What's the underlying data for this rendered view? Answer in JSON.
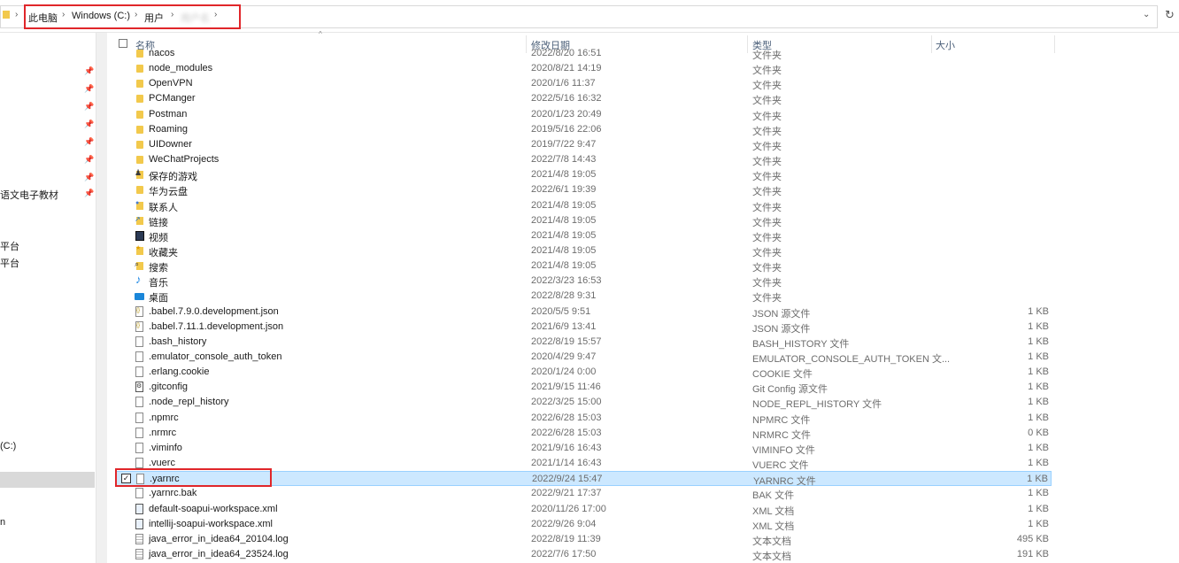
{
  "breadcrumb": {
    "items": [
      "此电脑",
      "Windows (C:)",
      "用户",
      "用户名"
    ],
    "user_redacted": "用户名"
  },
  "nav": {
    "labels": [
      {
        "text": "语文电子教材",
        "top": 0
      },
      {
        "text": "平台",
        "top": 0
      },
      {
        "text": "平台",
        "top": 0
      },
      {
        "text": "(C:)",
        "top": 0
      },
      {
        "text": "n",
        "top": 0
      }
    ]
  },
  "columns": {
    "name": "名称",
    "date": "修改日期",
    "type": "类型",
    "size": "大小"
  },
  "files": [
    {
      "name": "nacos",
      "date": "2022/8/20 16:51",
      "type": "文件夹",
      "size": "",
      "icon": "folder-icon"
    },
    {
      "name": "node_modules",
      "date": "2020/8/21 14:19",
      "type": "文件夹",
      "size": "",
      "icon": "folder-icon"
    },
    {
      "name": "OpenVPN",
      "date": "2020/1/6 11:37",
      "type": "文件夹",
      "size": "",
      "icon": "folder-icon"
    },
    {
      "name": "PCManger",
      "date": "2022/5/16 16:32",
      "type": "文件夹",
      "size": "",
      "icon": "folder-icon"
    },
    {
      "name": "Postman",
      "date": "2020/1/23 20:49",
      "type": "文件夹",
      "size": "",
      "icon": "folder-icon"
    },
    {
      "name": "Roaming",
      "date": "2019/5/16 22:06",
      "type": "文件夹",
      "size": "",
      "icon": "folder-icon"
    },
    {
      "name": "UIDowner",
      "date": "2019/7/22 9:47",
      "type": "文件夹",
      "size": "",
      "icon": "folder-icon"
    },
    {
      "name": "WeChatProjects",
      "date": "2022/7/8 14:43",
      "type": "文件夹",
      "size": "",
      "icon": "folder-icon"
    },
    {
      "name": "保存的游戏",
      "date": "2021/4/8 19:05",
      "type": "文件夹",
      "size": "",
      "icon": "saved-games-icon"
    },
    {
      "name": "华为云盘",
      "date": "2022/6/1 19:39",
      "type": "文件夹",
      "size": "",
      "icon": "folder-icon"
    },
    {
      "name": "联系人",
      "date": "2021/4/8 19:05",
      "type": "文件夹",
      "size": "",
      "icon": "contacts-icon"
    },
    {
      "name": "链接",
      "date": "2021/4/8 19:05",
      "type": "文件夹",
      "size": "",
      "icon": "links-icon"
    },
    {
      "name": "视频",
      "date": "2021/4/8 19:05",
      "type": "文件夹",
      "size": "",
      "icon": "video-icon"
    },
    {
      "name": "收藏夹",
      "date": "2021/4/8 19:05",
      "type": "文件夹",
      "size": "",
      "icon": "favorites-icon"
    },
    {
      "name": "搜索",
      "date": "2021/4/8 19:05",
      "type": "文件夹",
      "size": "",
      "icon": "searches-icon"
    },
    {
      "name": "音乐",
      "date": "2022/3/23 16:53",
      "type": "文件夹",
      "size": "",
      "icon": "music-icon"
    },
    {
      "name": "桌面",
      "date": "2022/8/28 9:31",
      "type": "文件夹",
      "size": "",
      "icon": "desktop-icon"
    },
    {
      "name": ".babel.7.9.0.development.json",
      "date": "2020/5/5 9:51",
      "type": "JSON 源文件",
      "size": "1 KB",
      "icon": "json-file-icon"
    },
    {
      "name": ".babel.7.11.1.development.json",
      "date": "2021/6/9 13:41",
      "type": "JSON 源文件",
      "size": "1 KB",
      "icon": "json-file-icon"
    },
    {
      "name": ".bash_history",
      "date": "2022/8/19 15:57",
      "type": "BASH_HISTORY 文件",
      "size": "1 KB",
      "icon": "file-icon"
    },
    {
      "name": ".emulator_console_auth_token",
      "date": "2020/4/29 9:47",
      "type": "EMULATOR_CONSOLE_AUTH_TOKEN 文...",
      "size": "1 KB",
      "icon": "file-icon"
    },
    {
      "name": ".erlang.cookie",
      "date": "2020/1/24 0:00",
      "type": "COOKIE 文件",
      "size": "1 KB",
      "icon": "file-icon"
    },
    {
      "name": ".gitconfig",
      "date": "2021/9/15 11:46",
      "type": "Git Config 源文件",
      "size": "1 KB",
      "icon": "gitconfig-file-icon"
    },
    {
      "name": ".node_repl_history",
      "date": "2022/3/25 15:00",
      "type": "NODE_REPL_HISTORY 文件",
      "size": "1 KB",
      "icon": "file-icon"
    },
    {
      "name": ".npmrc",
      "date": "2022/6/28 15:03",
      "type": "NPMRC 文件",
      "size": "1 KB",
      "icon": "file-icon"
    },
    {
      "name": ".nrmrc",
      "date": "2022/6/28 15:03",
      "type": "NRMRC 文件",
      "size": "0 KB",
      "icon": "file-icon"
    },
    {
      "name": ".viminfo",
      "date": "2021/9/16 16:43",
      "type": "VIMINFO 文件",
      "size": "1 KB",
      "icon": "file-icon"
    },
    {
      "name": ".vuerc",
      "date": "2021/1/14 16:43",
      "type": "VUERC 文件",
      "size": "1 KB",
      "icon": "file-icon"
    },
    {
      "name": ".yarnrc",
      "date": "2022/9/24 15:47",
      "type": "YARNRC 文件",
      "size": "1 KB",
      "icon": "file-icon",
      "selected": true
    },
    {
      "name": ".yarnrc.bak",
      "date": "2022/9/21 17:37",
      "type": "BAK 文件",
      "size": "1 KB",
      "icon": "file-icon"
    },
    {
      "name": "default-soapui-workspace.xml",
      "date": "2020/11/26 17:00",
      "type": "XML 文档",
      "size": "1 KB",
      "icon": "xml-file-icon"
    },
    {
      "name": "intellij-soapui-workspace.xml",
      "date": "2022/9/26 9:04",
      "type": "XML 文档",
      "size": "1 KB",
      "icon": "xml-file-icon"
    },
    {
      "name": "java_error_in_idea64_20104.log",
      "date": "2022/8/19 11:39",
      "type": "文本文档",
      "size": "495 KB",
      "icon": "text-file-icon"
    },
    {
      "name": "java_error_in_idea64_23524.log",
      "date": "2022/7/6 17:50",
      "type": "文本文档",
      "size": "191 KB",
      "icon": "text-file-icon"
    }
  ]
}
